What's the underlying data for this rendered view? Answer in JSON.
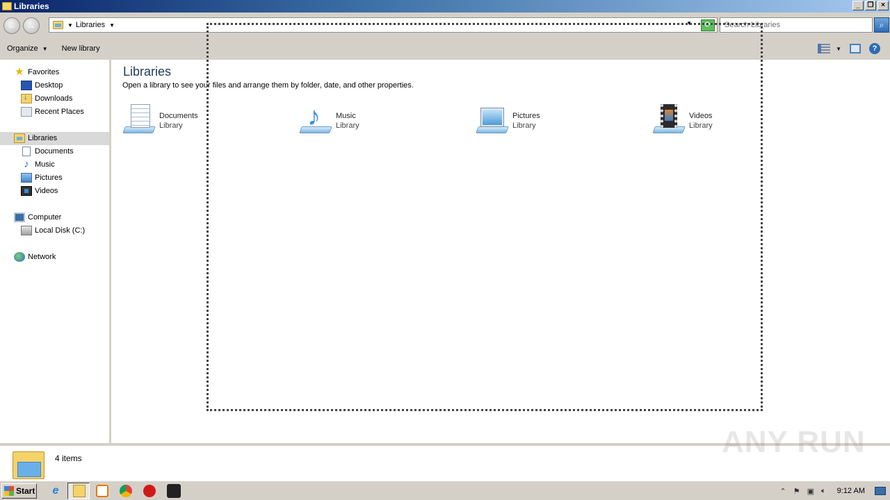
{
  "window": {
    "title": "Libraries",
    "buttons": {
      "minimize": "_",
      "restore": "❐",
      "close": "×"
    }
  },
  "address_bar": {
    "back_glyph": "←",
    "forward_glyph": "→",
    "path": "Libraries",
    "search_placeholder": "Search Libraries",
    "refresh_glyph": "⟳",
    "search_glyph": "⌕"
  },
  "command_bar": {
    "organize": "Organize",
    "new_library": "New library",
    "help": "?"
  },
  "nav_pane": {
    "favorites": {
      "label": "Favorites",
      "items": [
        "Desktop",
        "Downloads",
        "Recent Places"
      ]
    },
    "libraries": {
      "label": "Libraries",
      "items": [
        "Documents",
        "Music",
        "Pictures",
        "Videos"
      ]
    },
    "computer": {
      "label": "Computer",
      "items": [
        "Local Disk (C:)"
      ]
    },
    "network": {
      "label": "Network"
    }
  },
  "content": {
    "title": "Libraries",
    "description": "Open a library to see your files and arrange them by folder, date, and other properties.",
    "libraries": [
      {
        "name": "Documents",
        "type": "Library",
        "icon": "documents-library-icon"
      },
      {
        "name": "Music",
        "type": "Library",
        "icon": "music-library-icon"
      },
      {
        "name": "Pictures",
        "type": "Library",
        "icon": "pictures-library-icon"
      },
      {
        "name": "Videos",
        "type": "Library",
        "icon": "videos-library-icon"
      }
    ]
  },
  "details_pane": {
    "item_count": "4 items"
  },
  "watermark": "ANY RUN",
  "taskbar": {
    "start_label": "Start",
    "clock": "9:12 AM",
    "pinned": [
      "internet-explorer-icon",
      "windows-explorer-icon",
      "media-player-icon",
      "chrome-icon",
      "opera-icon",
      "app-icon"
    ]
  },
  "colors": {
    "title_gradient_start": "#0a246a",
    "title_gradient_end": "#a6caf0",
    "library_title": "#1e395b",
    "chrome_gray": "#d4d0c8"
  }
}
